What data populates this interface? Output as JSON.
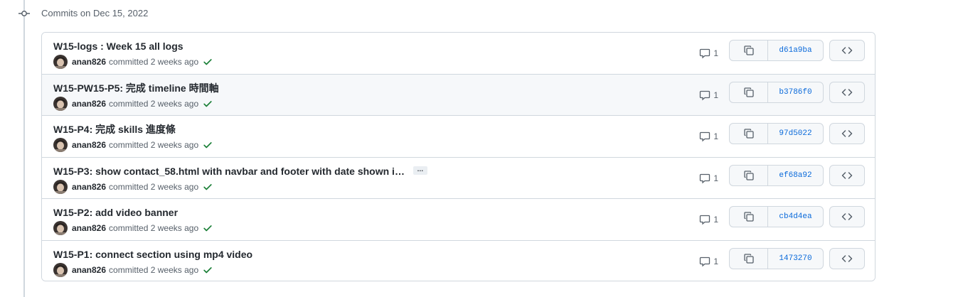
{
  "timeline": {
    "header": "Commits on Dec 15, 2022"
  },
  "commits": [
    {
      "title": "W15-logs : Week 15 all logs",
      "author": "anan826",
      "action": "committed",
      "time": "2 weeks ago",
      "comments": "1",
      "sha": "d61a9ba",
      "truncated": false
    },
    {
      "title": "W15-PW15-P5: 完成 timeline 時間軸",
      "author": "anan826",
      "action": "committed",
      "time": "2 weeks ago",
      "comments": "1",
      "sha": "b3786f0",
      "truncated": false
    },
    {
      "title": "W15-P4: 完成 skills 進度條",
      "author": "anan826",
      "action": "committed",
      "time": "2 weeks ago",
      "comments": "1",
      "sha": "97d5022",
      "truncated": false
    },
    {
      "title": "W15-P3: show contact_58.html with navbar and footer with date shown i…",
      "author": "anan826",
      "action": "committed",
      "time": "2 weeks ago",
      "comments": "1",
      "sha": "ef68a92",
      "truncated": true,
      "expand_label": "…"
    },
    {
      "title": "W15-P2: add video banner",
      "author": "anan826",
      "action": "committed",
      "time": "2 weeks ago",
      "comments": "1",
      "sha": "cb4d4ea",
      "truncated": false
    },
    {
      "title": "W15-P1: connect section using mp4 video",
      "author": "anan826",
      "action": "committed",
      "time": "2 weeks ago",
      "comments": "1",
      "sha": "1473270",
      "truncated": false
    }
  ],
  "colors": {
    "link": "#0969da",
    "success": "#1a7f37",
    "border": "#d0d7de",
    "muted": "#57606a"
  }
}
